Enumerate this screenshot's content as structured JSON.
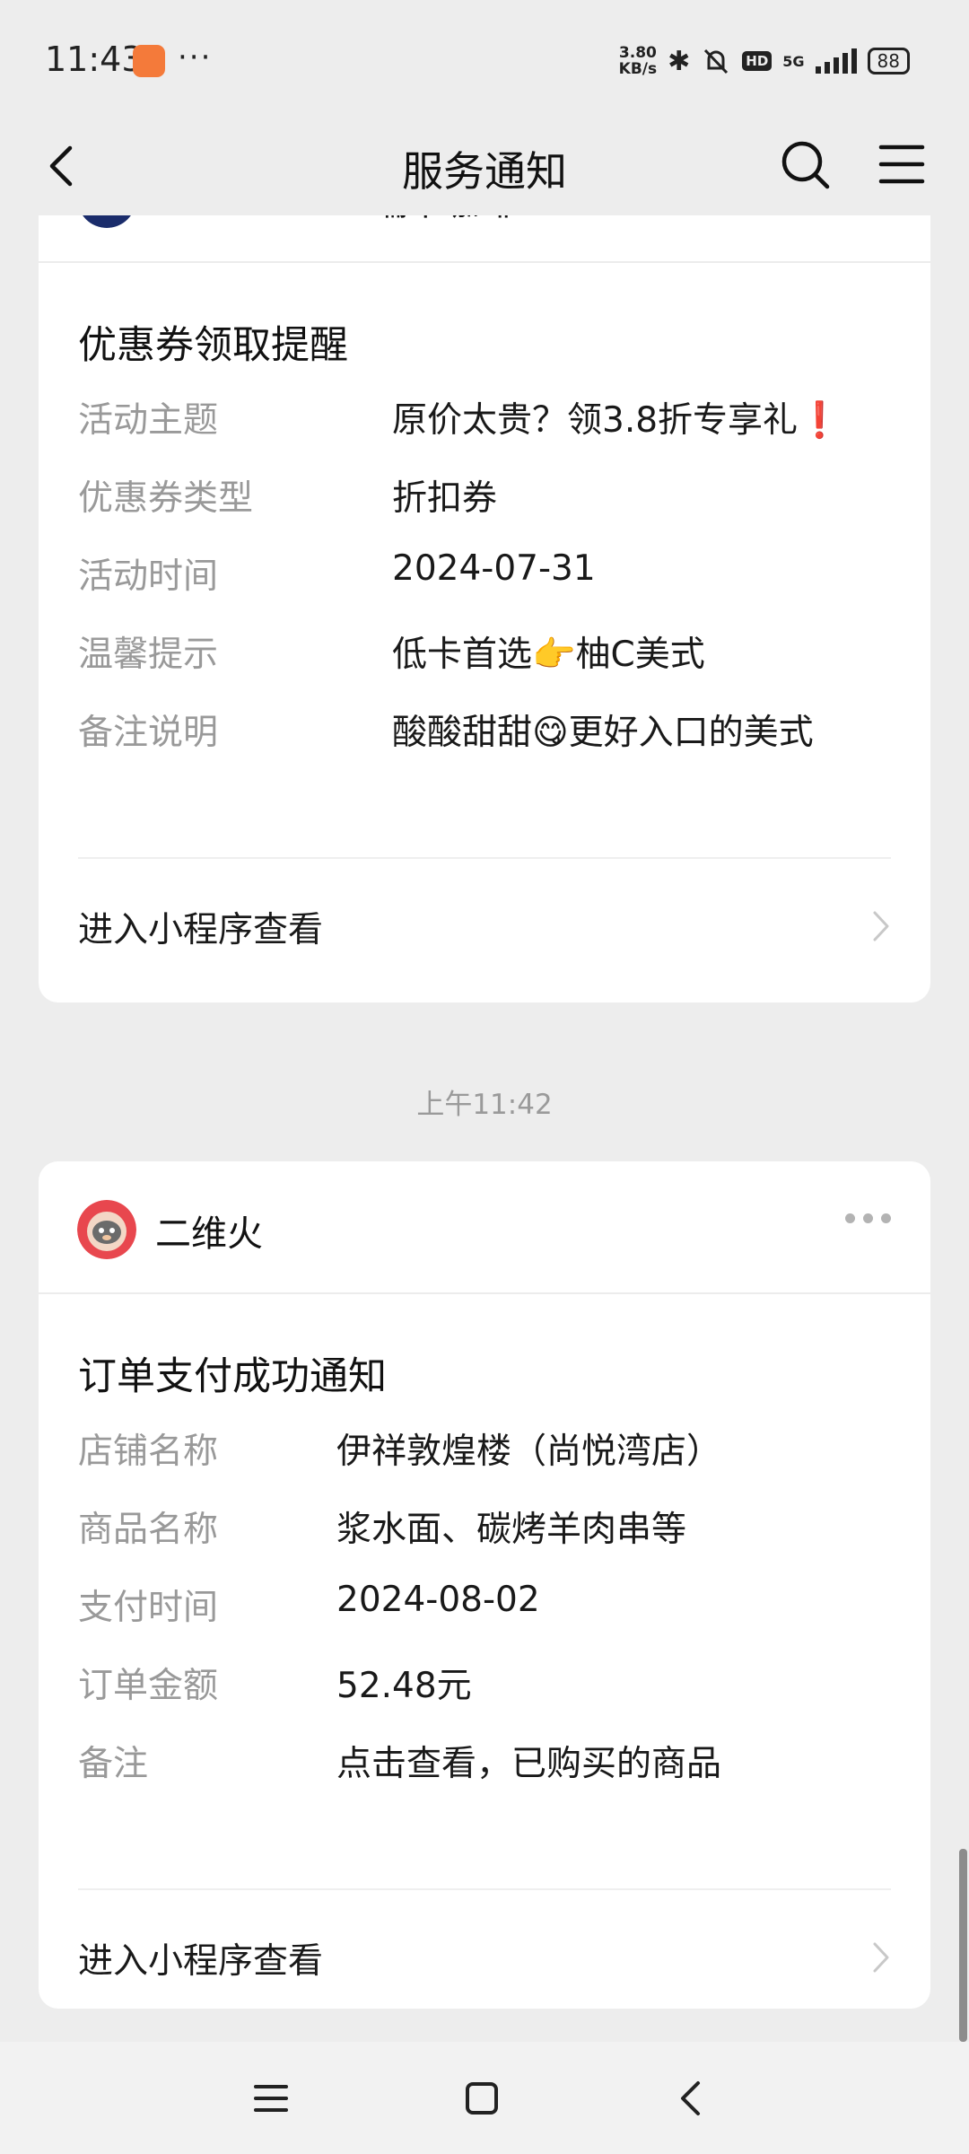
{
  "status_bar": {
    "time": "11:43",
    "notification_app_icon": "orange-app-icon",
    "more": "···",
    "net_speed_value": "3.80",
    "net_speed_unit": "KB/s",
    "hd_badge": "HD",
    "network": "5G",
    "battery": "88"
  },
  "navbar": {
    "title": "服务通知",
    "back_icon": "chevron-left-icon",
    "search_icon": "search-icon",
    "menu_icon": "hamburger-menu-icon"
  },
  "card1": {
    "account_name": "luckincoffee瑞幸咖啡",
    "title": "优惠券领取提醒",
    "rows": [
      {
        "label": "活动主题",
        "value": "原价太贵？领3.8折专享礼❗"
      },
      {
        "label": "优惠券类型",
        "value": "折扣券"
      },
      {
        "label": "活动时间",
        "value": "2024-07-31"
      },
      {
        "label": "温馨提示",
        "value": "低卡首选👉柚C美式"
      },
      {
        "label": "备注说明",
        "value": "酸酸甜甜😋更好入口的美式"
      }
    ],
    "enter_label": "进入小程序查看"
  },
  "timestamp": "上午11:42",
  "card2": {
    "account_name": "二维火",
    "title": "订单支付成功通知",
    "rows": [
      {
        "label": "店铺名称",
        "value": "伊祥敦煌楼（尚悦湾店）"
      },
      {
        "label": "商品名称",
        "value": "浆水面、碳烤羊肉串等"
      },
      {
        "label": "支付时间",
        "value": "2024-08-02"
      },
      {
        "label": "订单金额",
        "value": "52.48元"
      },
      {
        "label": "备注",
        "value": "点击查看，已购买的商品"
      }
    ],
    "enter_label": "进入小程序查看"
  },
  "colors": {
    "background": "#ededed",
    "card": "#ffffff",
    "label_gray": "#999999",
    "accent_orange": "#f47a3a"
  }
}
